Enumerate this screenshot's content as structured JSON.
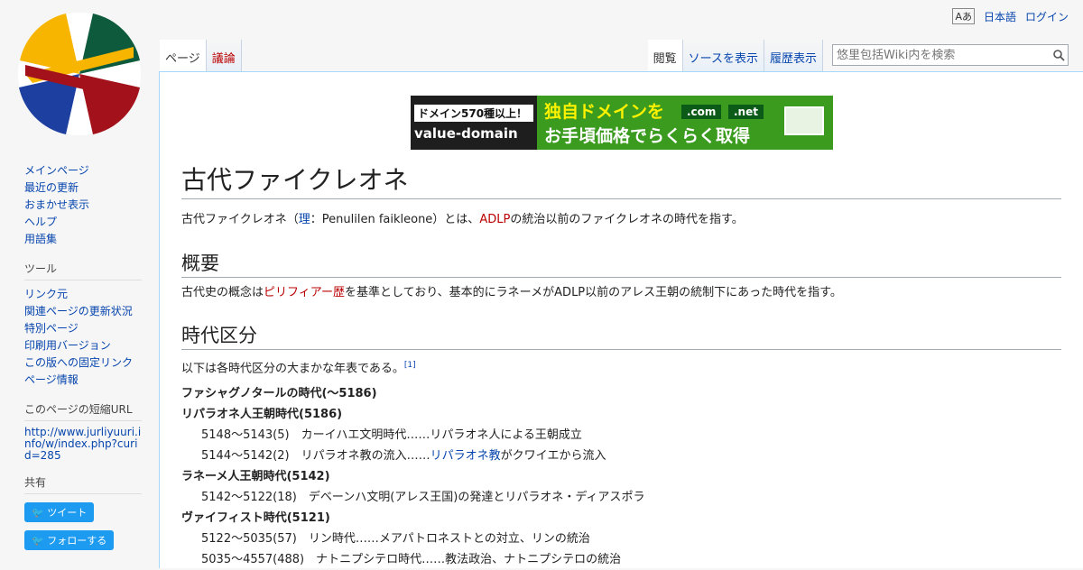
{
  "personal": {
    "lang_icon": "Aあ",
    "language": "日本語",
    "login": "ログイン"
  },
  "tabs_left": [
    {
      "label": "ページ",
      "selected": true
    },
    {
      "label": "議論",
      "new": true
    }
  ],
  "tabs_right": [
    {
      "label": "閲覧",
      "selected": true
    },
    {
      "label": "ソースを表示"
    },
    {
      "label": "履歴表示"
    }
  ],
  "search": {
    "placeholder": "悠里包括Wiki内を検索"
  },
  "sidebar": {
    "nav": [
      "メインページ",
      "最近の更新",
      "おまかせ表示",
      "ヘルプ",
      "用語集"
    ],
    "tools_heading": "ツール",
    "tools": [
      "リンク元",
      "関連ページの更新状況",
      "特別ページ",
      "印刷用バージョン",
      "この版への固定リンク",
      "ページ情報"
    ],
    "shorturl_heading": "このページの短縮URL",
    "shorturl": "http://www.jurliyuuri.info/w/index.php?curid=285",
    "share_heading": "共有",
    "tweet": "ツイート",
    "follow": "フォローする"
  },
  "banner": {
    "tag": "ドメイン570種以上！",
    "brand": "value-domain",
    "headline1": "独自ドメインを",
    "headline2": "お手頃価格でらくらく取得",
    "dom1": ".com",
    "dom2": ".net"
  },
  "article": {
    "title": "古代ファイクレオネ",
    "intro_pre": "古代ファイクレオネ（",
    "intro_link": "理",
    "intro_mid": "：Penulilen faikleone）とは、",
    "intro_red": "ADLP",
    "intro_post": "の統治以前のファイクレオネの時代を指す。",
    "h2_overview": "概要",
    "overview_pre": "古代史の概念は",
    "overview_red": "ピリフィアー歴",
    "overview_post": "を基準としており、基本的にラネーメがADLP以前のアレス王朝の統制下にあった時代を指す。",
    "h2_eras": "時代区分",
    "eras_intro": "以下は各時代区分の大まかな年表である。",
    "eras_ref": "[1]",
    "era1": "ファシャグノタールの時代(～5186)",
    "era2": "リパラオネ人王朝時代(5186)",
    "era2_r1": "5148～5143(5)　カーイハエ文明時代……リパラオネ人による王朝成立",
    "era2_r2_pre": "5144～5142(2)　リパラオネ教の流入……",
    "era2_r2_link": "リパラオネ教",
    "era2_r2_post": "がクワイエから流入",
    "era3": "ラネーメ人王朝時代(5142)",
    "era3_r1": "5142～5122(18)　デベーンハ文明(アレス王国)の発達とリパラオネ・ディアスポラ",
    "era4": "ヴァイフィスト時代(5121)",
    "era4_r1": "5122～5035(57)　リン時代……メアパトロネストとの対立、リンの統治",
    "era4_r2": "5035～4557(488)　ナトニプシテロ時代……教法政治、ナトニプシテロの統治"
  },
  "colors": {
    "link": "#0645ad",
    "redlink": "#ba0000",
    "banner_green": "#3a9b1f",
    "twitter": "#1d9bf0"
  }
}
